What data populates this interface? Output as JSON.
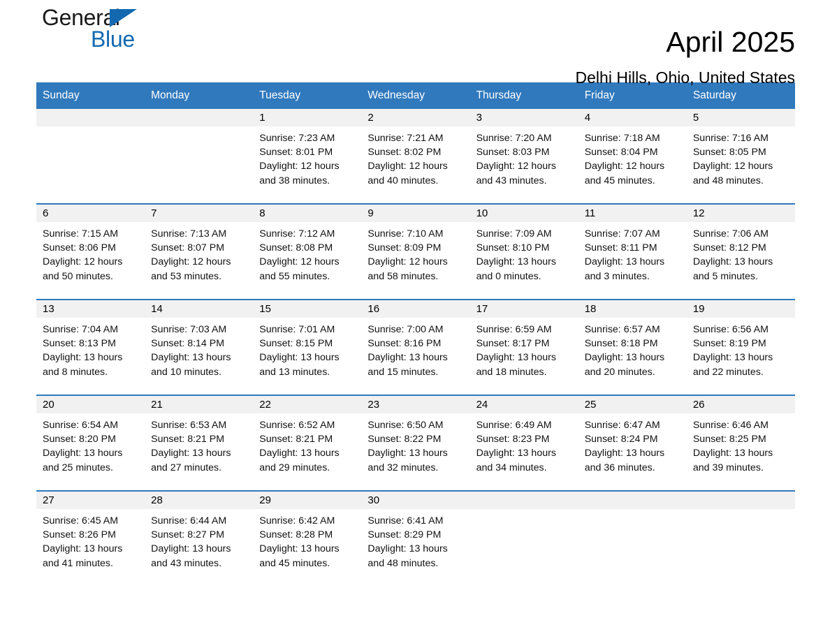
{
  "brand": {
    "name_part1": "General",
    "name_part2": "Blue",
    "triangle_color": "#1269b0",
    "text_color": "#1a1a1a"
  },
  "header": {
    "title": "April 2025",
    "subtitle": "Delhi Hills, Ohio, United States",
    "accent_color": "#3079bd",
    "band_color": "#f1f1f1"
  },
  "weekdays": [
    "Sunday",
    "Monday",
    "Tuesday",
    "Wednesday",
    "Thursday",
    "Friday",
    "Saturday"
  ],
  "weeks": [
    [
      {
        "day": "",
        "sunrise": "",
        "sunset": "",
        "daylight_1": "",
        "daylight_2": "",
        "empty": true
      },
      {
        "day": "",
        "sunrise": "",
        "sunset": "",
        "daylight_1": "",
        "daylight_2": "",
        "empty": true
      },
      {
        "day": "1",
        "sunrise": "Sunrise: 7:23 AM",
        "sunset": "Sunset: 8:01 PM",
        "daylight_1": "Daylight: 12 hours",
        "daylight_2": "and 38 minutes."
      },
      {
        "day": "2",
        "sunrise": "Sunrise: 7:21 AM",
        "sunset": "Sunset: 8:02 PM",
        "daylight_1": "Daylight: 12 hours",
        "daylight_2": "and 40 minutes."
      },
      {
        "day": "3",
        "sunrise": "Sunrise: 7:20 AM",
        "sunset": "Sunset: 8:03 PM",
        "daylight_1": "Daylight: 12 hours",
        "daylight_2": "and 43 minutes."
      },
      {
        "day": "4",
        "sunrise": "Sunrise: 7:18 AM",
        "sunset": "Sunset: 8:04 PM",
        "daylight_1": "Daylight: 12 hours",
        "daylight_2": "and 45 minutes."
      },
      {
        "day": "5",
        "sunrise": "Sunrise: 7:16 AM",
        "sunset": "Sunset: 8:05 PM",
        "daylight_1": "Daylight: 12 hours",
        "daylight_2": "and 48 minutes."
      }
    ],
    [
      {
        "day": "6",
        "sunrise": "Sunrise: 7:15 AM",
        "sunset": "Sunset: 8:06 PM",
        "daylight_1": "Daylight: 12 hours",
        "daylight_2": "and 50 minutes."
      },
      {
        "day": "7",
        "sunrise": "Sunrise: 7:13 AM",
        "sunset": "Sunset: 8:07 PM",
        "daylight_1": "Daylight: 12 hours",
        "daylight_2": "and 53 minutes."
      },
      {
        "day": "8",
        "sunrise": "Sunrise: 7:12 AM",
        "sunset": "Sunset: 8:08 PM",
        "daylight_1": "Daylight: 12 hours",
        "daylight_2": "and 55 minutes."
      },
      {
        "day": "9",
        "sunrise": "Sunrise: 7:10 AM",
        "sunset": "Sunset: 8:09 PM",
        "daylight_1": "Daylight: 12 hours",
        "daylight_2": "and 58 minutes."
      },
      {
        "day": "10",
        "sunrise": "Sunrise: 7:09 AM",
        "sunset": "Sunset: 8:10 PM",
        "daylight_1": "Daylight: 13 hours",
        "daylight_2": "and 0 minutes."
      },
      {
        "day": "11",
        "sunrise": "Sunrise: 7:07 AM",
        "sunset": "Sunset: 8:11 PM",
        "daylight_1": "Daylight: 13 hours",
        "daylight_2": "and 3 minutes."
      },
      {
        "day": "12",
        "sunrise": "Sunrise: 7:06 AM",
        "sunset": "Sunset: 8:12 PM",
        "daylight_1": "Daylight: 13 hours",
        "daylight_2": "and 5 minutes."
      }
    ],
    [
      {
        "day": "13",
        "sunrise": "Sunrise: 7:04 AM",
        "sunset": "Sunset: 8:13 PM",
        "daylight_1": "Daylight: 13 hours",
        "daylight_2": "and 8 minutes."
      },
      {
        "day": "14",
        "sunrise": "Sunrise: 7:03 AM",
        "sunset": "Sunset: 8:14 PM",
        "daylight_1": "Daylight: 13 hours",
        "daylight_2": "and 10 minutes."
      },
      {
        "day": "15",
        "sunrise": "Sunrise: 7:01 AM",
        "sunset": "Sunset: 8:15 PM",
        "daylight_1": "Daylight: 13 hours",
        "daylight_2": "and 13 minutes."
      },
      {
        "day": "16",
        "sunrise": "Sunrise: 7:00 AM",
        "sunset": "Sunset: 8:16 PM",
        "daylight_1": "Daylight: 13 hours",
        "daylight_2": "and 15 minutes."
      },
      {
        "day": "17",
        "sunrise": "Sunrise: 6:59 AM",
        "sunset": "Sunset: 8:17 PM",
        "daylight_1": "Daylight: 13 hours",
        "daylight_2": "and 18 minutes."
      },
      {
        "day": "18",
        "sunrise": "Sunrise: 6:57 AM",
        "sunset": "Sunset: 8:18 PM",
        "daylight_1": "Daylight: 13 hours",
        "daylight_2": "and 20 minutes."
      },
      {
        "day": "19",
        "sunrise": "Sunrise: 6:56 AM",
        "sunset": "Sunset: 8:19 PM",
        "daylight_1": "Daylight: 13 hours",
        "daylight_2": "and 22 minutes."
      }
    ],
    [
      {
        "day": "20",
        "sunrise": "Sunrise: 6:54 AM",
        "sunset": "Sunset: 8:20 PM",
        "daylight_1": "Daylight: 13 hours",
        "daylight_2": "and 25 minutes."
      },
      {
        "day": "21",
        "sunrise": "Sunrise: 6:53 AM",
        "sunset": "Sunset: 8:21 PM",
        "daylight_1": "Daylight: 13 hours",
        "daylight_2": "and 27 minutes."
      },
      {
        "day": "22",
        "sunrise": "Sunrise: 6:52 AM",
        "sunset": "Sunset: 8:21 PM",
        "daylight_1": "Daylight: 13 hours",
        "daylight_2": "and 29 minutes."
      },
      {
        "day": "23",
        "sunrise": "Sunrise: 6:50 AM",
        "sunset": "Sunset: 8:22 PM",
        "daylight_1": "Daylight: 13 hours",
        "daylight_2": "and 32 minutes."
      },
      {
        "day": "24",
        "sunrise": "Sunrise: 6:49 AM",
        "sunset": "Sunset: 8:23 PM",
        "daylight_1": "Daylight: 13 hours",
        "daylight_2": "and 34 minutes."
      },
      {
        "day": "25",
        "sunrise": "Sunrise: 6:47 AM",
        "sunset": "Sunset: 8:24 PM",
        "daylight_1": "Daylight: 13 hours",
        "daylight_2": "and 36 minutes."
      },
      {
        "day": "26",
        "sunrise": "Sunrise: 6:46 AM",
        "sunset": "Sunset: 8:25 PM",
        "daylight_1": "Daylight: 13 hours",
        "daylight_2": "and 39 minutes."
      }
    ],
    [
      {
        "day": "27",
        "sunrise": "Sunrise: 6:45 AM",
        "sunset": "Sunset: 8:26 PM",
        "daylight_1": "Daylight: 13 hours",
        "daylight_2": "and 41 minutes."
      },
      {
        "day": "28",
        "sunrise": "Sunrise: 6:44 AM",
        "sunset": "Sunset: 8:27 PM",
        "daylight_1": "Daylight: 13 hours",
        "daylight_2": "and 43 minutes."
      },
      {
        "day": "29",
        "sunrise": "Sunrise: 6:42 AM",
        "sunset": "Sunset: 8:28 PM",
        "daylight_1": "Daylight: 13 hours",
        "daylight_2": "and 45 minutes."
      },
      {
        "day": "30",
        "sunrise": "Sunrise: 6:41 AM",
        "sunset": "Sunset: 8:29 PM",
        "daylight_1": "Daylight: 13 hours",
        "daylight_2": "and 48 minutes."
      },
      {
        "day": "",
        "sunrise": "",
        "sunset": "",
        "daylight_1": "",
        "daylight_2": "",
        "empty": true
      },
      {
        "day": "",
        "sunrise": "",
        "sunset": "",
        "daylight_1": "",
        "daylight_2": "",
        "empty": true
      },
      {
        "day": "",
        "sunrise": "",
        "sunset": "",
        "daylight_1": "",
        "daylight_2": "",
        "empty": true
      }
    ]
  ]
}
